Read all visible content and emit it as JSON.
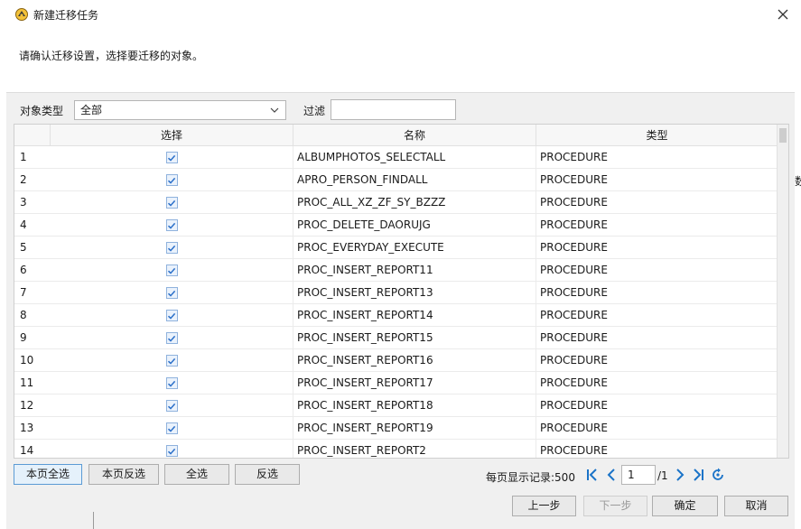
{
  "window": {
    "title": "新建迁移任务",
    "close_icon": "close-icon",
    "app_icon": "tasks-icon"
  },
  "instruction": "请确认迁移设置，选择要迁移的对象。",
  "filter": {
    "type_label": "对象类型",
    "type_value": "全部",
    "filter_label": "过滤",
    "filter_value": ""
  },
  "table": {
    "columns": [
      "选择",
      "名称",
      "类型"
    ],
    "rows": [
      {
        "num": "1",
        "checked": true,
        "name": "ALBUMPHOTOS_SELECTALL",
        "type": "PROCEDURE"
      },
      {
        "num": "2",
        "checked": true,
        "name": "APRO_PERSON_FINDALL",
        "type": "PROCEDURE"
      },
      {
        "num": "3",
        "checked": true,
        "name": "PROC_ALL_XZ_ZF_SY_BZZZ",
        "type": "PROCEDURE"
      },
      {
        "num": "4",
        "checked": true,
        "name": "PROC_DELETE_DAORUJG",
        "type": "PROCEDURE"
      },
      {
        "num": "5",
        "checked": true,
        "name": "PROC_EVERYDAY_EXECUTE",
        "type": "PROCEDURE"
      },
      {
        "num": "6",
        "checked": true,
        "name": "PROC_INSERT_REPORT11",
        "type": "PROCEDURE"
      },
      {
        "num": "7",
        "checked": true,
        "name": "PROC_INSERT_REPORT13",
        "type": "PROCEDURE"
      },
      {
        "num": "8",
        "checked": true,
        "name": "PROC_INSERT_REPORT14",
        "type": "PROCEDURE"
      },
      {
        "num": "9",
        "checked": true,
        "name": "PROC_INSERT_REPORT15",
        "type": "PROCEDURE"
      },
      {
        "num": "10",
        "checked": true,
        "name": "PROC_INSERT_REPORT16",
        "type": "PROCEDURE"
      },
      {
        "num": "11",
        "checked": true,
        "name": "PROC_INSERT_REPORT17",
        "type": "PROCEDURE"
      },
      {
        "num": "12",
        "checked": true,
        "name": "PROC_INSERT_REPORT18",
        "type": "PROCEDURE"
      },
      {
        "num": "13",
        "checked": true,
        "name": "PROC_INSERT_REPORT19",
        "type": "PROCEDURE"
      },
      {
        "num": "14",
        "checked": true,
        "name": "PROC_INSERT_REPORT2",
        "type": "PROCEDURE"
      }
    ]
  },
  "selection_buttons": {
    "select_page": "本页全选",
    "invert_page": "本页反选",
    "select_all": "全选",
    "invert_all": "反选"
  },
  "pager": {
    "per_page_label": "每页显示记录:",
    "per_page_value": "500",
    "current_page": "1",
    "total_pages": "/1"
  },
  "footer": {
    "prev": "上一步",
    "next": "下一步",
    "ok": "确定",
    "cancel": "取消"
  },
  "background_text": "数",
  "colors": {
    "accent": "#1a73c8",
    "check": "#2a6fc9"
  }
}
